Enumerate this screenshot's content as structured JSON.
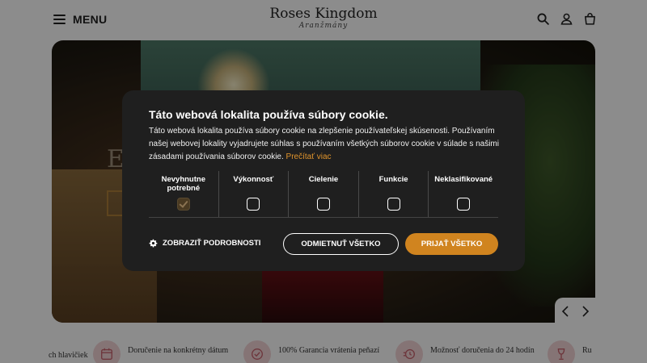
{
  "header": {
    "menu_label": "MENU",
    "logo_title": "Roses Kingdom",
    "logo_subtitle": "Aranžmány",
    "icons": [
      "search-icon",
      "user-icon",
      "cart-icon"
    ]
  },
  "hero": {
    "heading_fragment": "E",
    "carousel": {
      "prev_icon": "chevron-left-icon",
      "next_icon": "chevron-right-icon"
    }
  },
  "features": {
    "partial_left": "ch hlavičiek",
    "items": [
      {
        "icon": "calendar-icon",
        "text": "Doručenie na konkrétny dátum"
      },
      {
        "icon": "guarantee-icon",
        "text": "100% Garancia vrátenia peňazí"
      },
      {
        "icon": "fast-delivery-icon",
        "text": "Možnosť doručenia do 24 hodín"
      },
      {
        "icon": "wine-glass-icon",
        "text": "Ru"
      }
    ]
  },
  "cookie": {
    "title": "Táto webová lokalita používa súbory cookie.",
    "body": "Táto webová lokalita používa súbory cookie na zlepšenie používateľskej skúsenosti. Používaním našej webovej lokality vyjadrujete súhlas s používaním všetkých súborov cookie v súlade s našimi zásadami používania súborov cookie.",
    "read_more": "Prečítať viac",
    "categories": [
      {
        "label": "Nevyhnutne potrebné",
        "checked": true,
        "locked": true
      },
      {
        "label": "Výkonnosť",
        "checked": false
      },
      {
        "label": "Cielenie",
        "checked": false
      },
      {
        "label": "Funkcie",
        "checked": false
      },
      {
        "label": "Neklasifikované",
        "checked": false
      }
    ],
    "details_label": "ZOBRAZIŤ PODROBNOSTI",
    "reject_label": "ODMIETNUŤ VŠETKO",
    "accept_label": "PRIJAŤ VŠETKO",
    "accent_color": "#d0841f"
  }
}
